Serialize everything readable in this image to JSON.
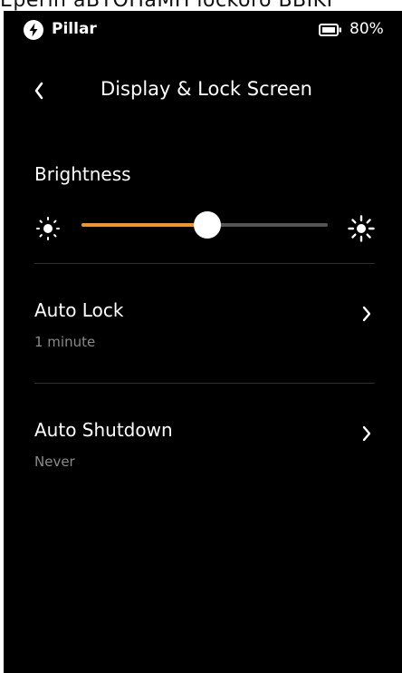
{
  "top_strip": {
    "text": "Eperin aBTOHaMH lockoro BBIKI"
  },
  "status_bar": {
    "app_name": "Pillar",
    "battery": "80%",
    "app_icon": "bolt-icon",
    "battery_icon": "battery-icon"
  },
  "header": {
    "title": "Display & Lock Screen",
    "back_icon": "chevron-left-icon"
  },
  "brightness": {
    "label": "Brightness",
    "level": 0.51,
    "low_icon": "sun-dim-icon",
    "high_icon": "sun-bright-icon"
  },
  "settings": [
    {
      "title": "Auto Lock",
      "value": "1 minute"
    },
    {
      "title": "Auto Shutdown",
      "value": "Never"
    }
  ],
  "colors": {
    "accent": "#f0952a",
    "background": "#000000",
    "secondary_text": "#8a8a8a",
    "track": "#555555"
  }
}
